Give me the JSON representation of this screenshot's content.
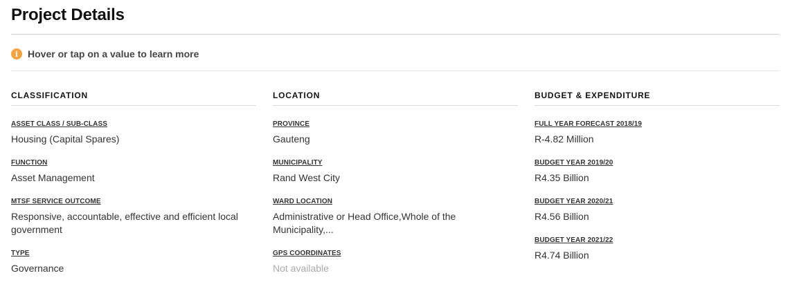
{
  "page": {
    "title": "Project Details"
  },
  "hint": {
    "text": "Hover or tap on a value to learn more",
    "icon": "info-icon",
    "icon_color": "#f4a340"
  },
  "columns": [
    {
      "heading": "CLASSIFICATION",
      "fields": [
        {
          "label": "ASSET CLASS / SUB-CLASS",
          "value": "Housing (Capital Spares)"
        },
        {
          "label": "FUNCTION",
          "value": "Asset Management"
        },
        {
          "label": "MTSF SERVICE OUTCOME",
          "value": "Responsive, accountable, effective and efficient local government"
        },
        {
          "label": "TYPE",
          "value": "Governance"
        }
      ]
    },
    {
      "heading": "LOCATION",
      "fields": [
        {
          "label": "PROVINCE",
          "value": "Gauteng"
        },
        {
          "label": "MUNICIPALITY",
          "value": "Rand West City"
        },
        {
          "label": "WARD LOCATION",
          "value": "Administrative or Head Office,Whole of the Municipality,..."
        },
        {
          "label": "GPS COORDINATES",
          "value": "Not available"
        }
      ]
    },
    {
      "heading": "BUDGET & EXPENDITURE",
      "fields": [
        {
          "label": "FULL YEAR FORECAST 2018/19",
          "value": "R-4.82 Million"
        },
        {
          "label": "BUDGET YEAR 2019/20",
          "value": "R4.35 Billion"
        },
        {
          "label": "BUDGET YEAR 2020/21",
          "value": "R4.56 Billion"
        },
        {
          "label": "BUDGET YEAR 2021/22",
          "value": "R4.74 Billion"
        }
      ]
    }
  ]
}
